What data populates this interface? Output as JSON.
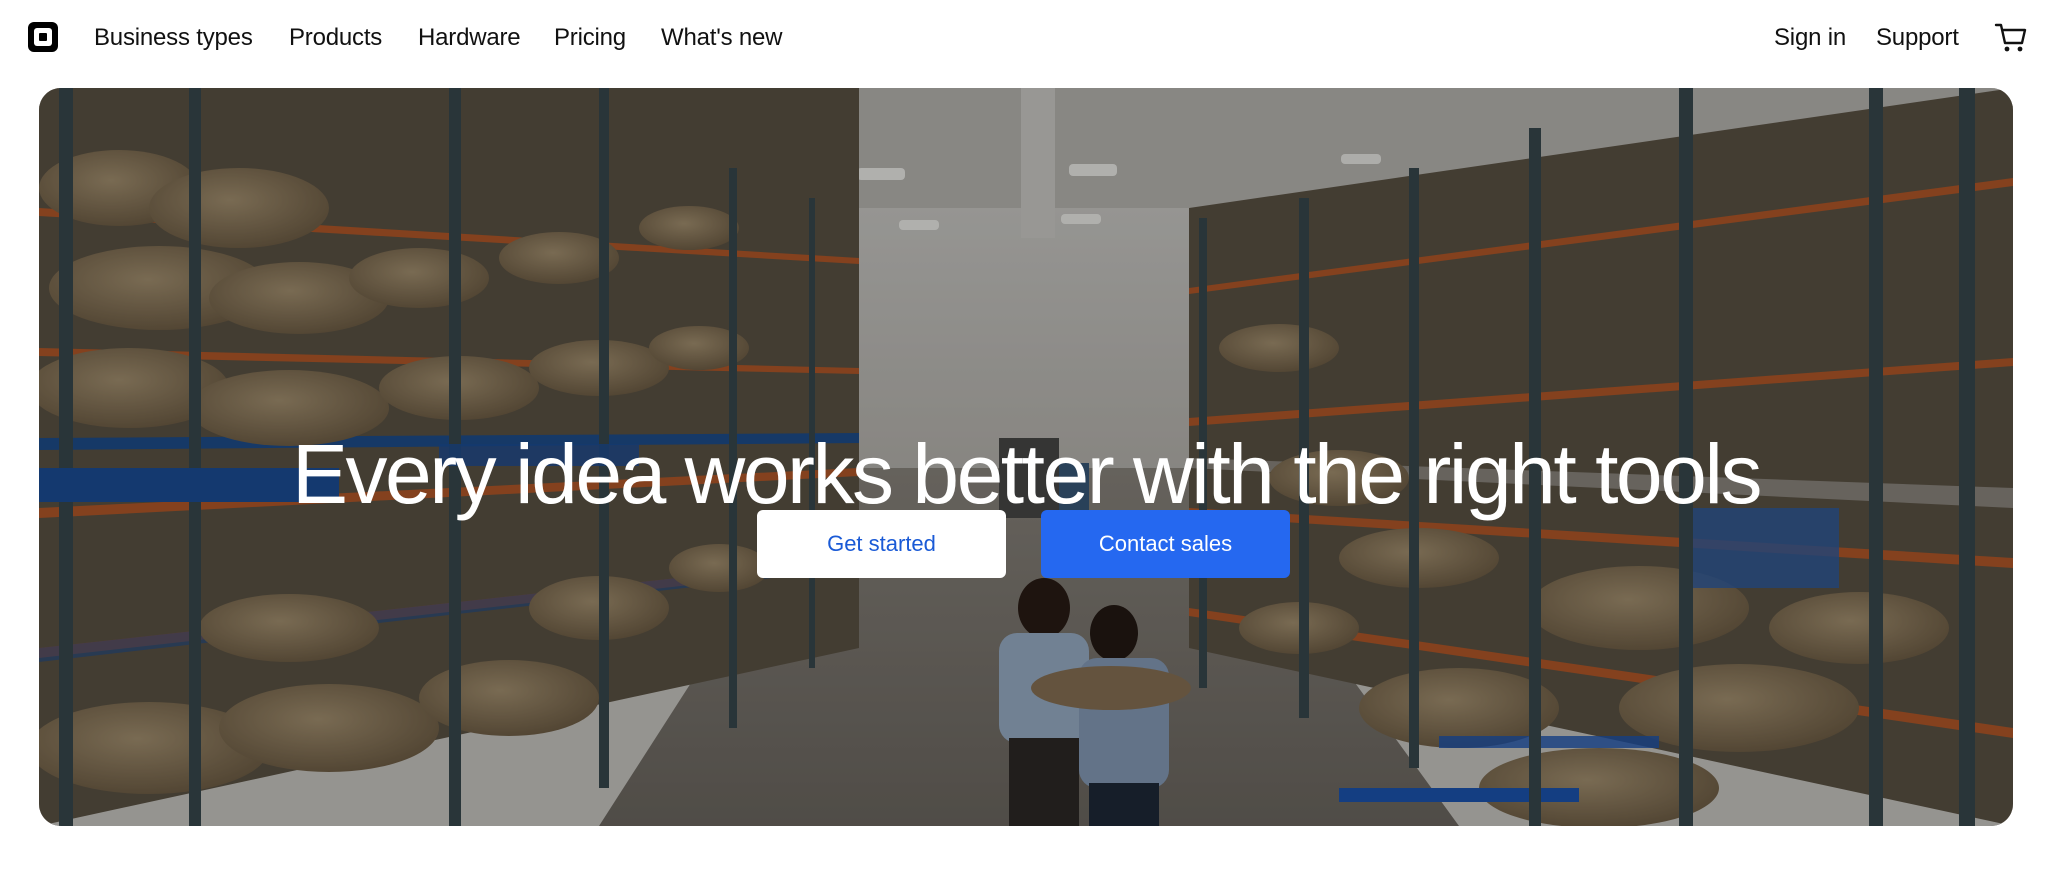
{
  "nav": {
    "logo_icon": "square-logo-icon",
    "links": [
      "Business types",
      "Products",
      "Hardware",
      "Pricing",
      "What's new"
    ],
    "sign_in": "Sign in",
    "support": "Support",
    "cart_icon": "cart-icon"
  },
  "hero": {
    "headline": "Every idea works better with the right tools",
    "get_started": "Get started",
    "contact_sales": "Contact sales",
    "colors": {
      "primary_button": "#2568f0",
      "secondary_button": "#ffffff",
      "headline": "#ffffff"
    }
  }
}
